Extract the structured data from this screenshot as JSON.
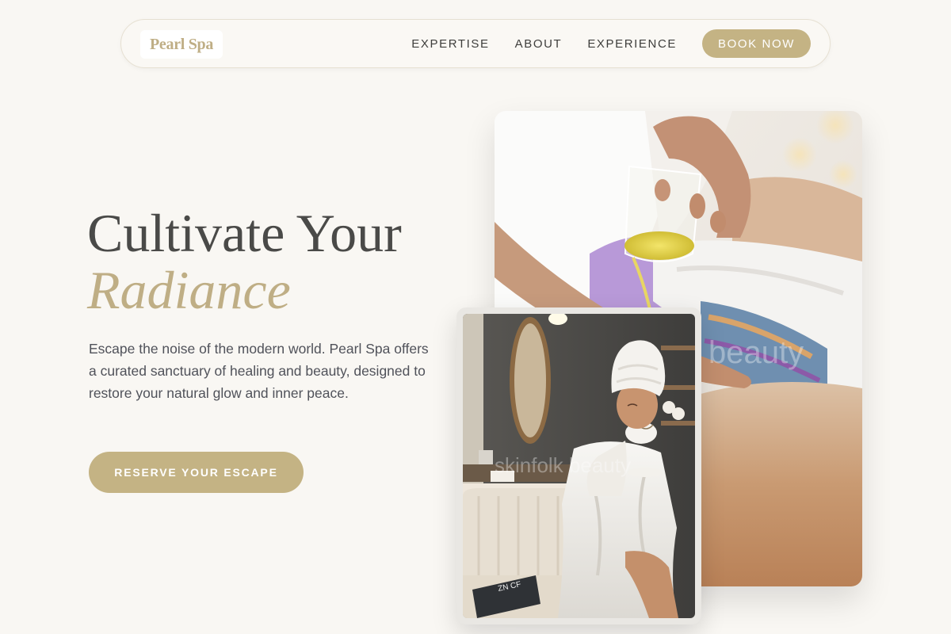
{
  "nav": {
    "logo": "Pearl Spa",
    "links": [
      "EXPERTISE",
      "ABOUT",
      "EXPERIENCE"
    ],
    "book_label": "BOOK NOW"
  },
  "hero": {
    "title_line1": "Cultivate Your",
    "title_line2": "Radiance",
    "description": "Escape the noise of the modern world. Pearl Spa offers a curated sanctuary of healing and beauty, designed to restore your natural glow and inner peace.",
    "cta_label": "RESERVE YOUR ESCAPE"
  },
  "images": {
    "main_watermark": "beauty",
    "small_watermark": "skinfolk beauty",
    "magazine_text": "ZN CF"
  },
  "colors": {
    "accent": "#c4b384",
    "background": "#f9f7f3",
    "heading": "#4a4a48"
  }
}
